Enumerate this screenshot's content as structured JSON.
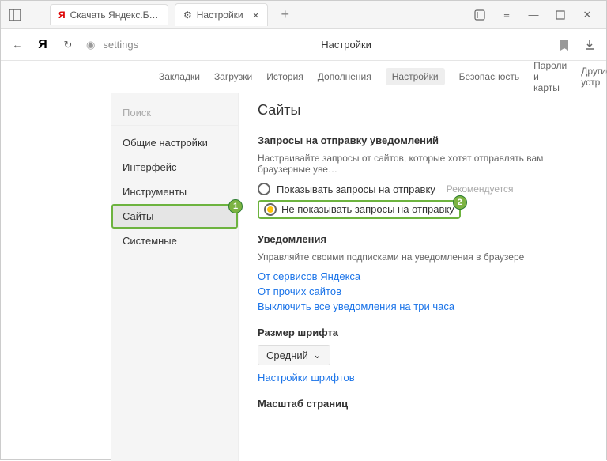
{
  "titlebar": {
    "tab1_label": "Скачать Яндекс.Браузер д…",
    "tab2_label": "Настройки"
  },
  "toolbar": {
    "addr_text": "settings",
    "page_title": "Настройки"
  },
  "nav": {
    "bookmarks": "Закладки",
    "downloads": "Загрузки",
    "history": "История",
    "addons": "Дополнения",
    "settings": "Настройки",
    "security": "Безопасность",
    "passwords": "Пароли и карты",
    "other": "Другие устр"
  },
  "sidebar": {
    "search_placeholder": "Поиск",
    "items": [
      "Общие настройки",
      "Интерфейс",
      "Инструменты",
      "Сайты",
      "Системные"
    ]
  },
  "badges": {
    "one": "1",
    "two": "2"
  },
  "content": {
    "heading": "Сайты",
    "notif_requests_title": "Запросы на отправку уведомлений",
    "notif_requests_desc": "Настраивайте запросы от сайтов, которые хотят отправлять вам браузерные уве…",
    "radio_show": "Показывать запросы на отправку",
    "radio_show_hint": "Рекомендуется",
    "radio_hide": "Не показывать запросы на отправку",
    "notifications_title": "Уведомления",
    "notifications_desc": "Управляйте своими подписками на уведомления в браузере",
    "link_yandex": "От сервисов Яндекса",
    "link_others": "От прочих сайтов",
    "link_mute": "Выключить все уведомления на три часа",
    "fontsize_title": "Размер шрифта",
    "fontsize_value": "Средний",
    "link_fonts": "Настройки шрифтов",
    "zoom_title": "Масштаб страниц"
  }
}
